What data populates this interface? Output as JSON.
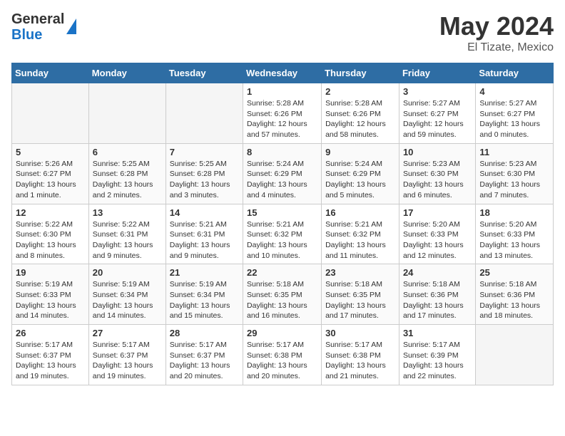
{
  "header": {
    "logo_general": "General",
    "logo_blue": "Blue",
    "title": "May 2024",
    "location": "El Tizate, Mexico"
  },
  "weekdays": [
    "Sunday",
    "Monday",
    "Tuesday",
    "Wednesday",
    "Thursday",
    "Friday",
    "Saturday"
  ],
  "weeks": [
    [
      {
        "day": "",
        "info": ""
      },
      {
        "day": "",
        "info": ""
      },
      {
        "day": "",
        "info": ""
      },
      {
        "day": "1",
        "info": "Sunrise: 5:28 AM\nSunset: 6:26 PM\nDaylight: 12 hours and 57 minutes."
      },
      {
        "day": "2",
        "info": "Sunrise: 5:28 AM\nSunset: 6:26 PM\nDaylight: 12 hours and 58 minutes."
      },
      {
        "day": "3",
        "info": "Sunrise: 5:27 AM\nSunset: 6:27 PM\nDaylight: 12 hours and 59 minutes."
      },
      {
        "day": "4",
        "info": "Sunrise: 5:27 AM\nSunset: 6:27 PM\nDaylight: 13 hours and 0 minutes."
      }
    ],
    [
      {
        "day": "5",
        "info": "Sunrise: 5:26 AM\nSunset: 6:27 PM\nDaylight: 13 hours and 1 minute."
      },
      {
        "day": "6",
        "info": "Sunrise: 5:25 AM\nSunset: 6:28 PM\nDaylight: 13 hours and 2 minutes."
      },
      {
        "day": "7",
        "info": "Sunrise: 5:25 AM\nSunset: 6:28 PM\nDaylight: 13 hours and 3 minutes."
      },
      {
        "day": "8",
        "info": "Sunrise: 5:24 AM\nSunset: 6:29 PM\nDaylight: 13 hours and 4 minutes."
      },
      {
        "day": "9",
        "info": "Sunrise: 5:24 AM\nSunset: 6:29 PM\nDaylight: 13 hours and 5 minutes."
      },
      {
        "day": "10",
        "info": "Sunrise: 5:23 AM\nSunset: 6:30 PM\nDaylight: 13 hours and 6 minutes."
      },
      {
        "day": "11",
        "info": "Sunrise: 5:23 AM\nSunset: 6:30 PM\nDaylight: 13 hours and 7 minutes."
      }
    ],
    [
      {
        "day": "12",
        "info": "Sunrise: 5:22 AM\nSunset: 6:30 PM\nDaylight: 13 hours and 8 minutes."
      },
      {
        "day": "13",
        "info": "Sunrise: 5:22 AM\nSunset: 6:31 PM\nDaylight: 13 hours and 9 minutes."
      },
      {
        "day": "14",
        "info": "Sunrise: 5:21 AM\nSunset: 6:31 PM\nDaylight: 13 hours and 9 minutes."
      },
      {
        "day": "15",
        "info": "Sunrise: 5:21 AM\nSunset: 6:32 PM\nDaylight: 13 hours and 10 minutes."
      },
      {
        "day": "16",
        "info": "Sunrise: 5:21 AM\nSunset: 6:32 PM\nDaylight: 13 hours and 11 minutes."
      },
      {
        "day": "17",
        "info": "Sunrise: 5:20 AM\nSunset: 6:33 PM\nDaylight: 13 hours and 12 minutes."
      },
      {
        "day": "18",
        "info": "Sunrise: 5:20 AM\nSunset: 6:33 PM\nDaylight: 13 hours and 13 minutes."
      }
    ],
    [
      {
        "day": "19",
        "info": "Sunrise: 5:19 AM\nSunset: 6:33 PM\nDaylight: 13 hours and 14 minutes."
      },
      {
        "day": "20",
        "info": "Sunrise: 5:19 AM\nSunset: 6:34 PM\nDaylight: 13 hours and 14 minutes."
      },
      {
        "day": "21",
        "info": "Sunrise: 5:19 AM\nSunset: 6:34 PM\nDaylight: 13 hours and 15 minutes."
      },
      {
        "day": "22",
        "info": "Sunrise: 5:18 AM\nSunset: 6:35 PM\nDaylight: 13 hours and 16 minutes."
      },
      {
        "day": "23",
        "info": "Sunrise: 5:18 AM\nSunset: 6:35 PM\nDaylight: 13 hours and 17 minutes."
      },
      {
        "day": "24",
        "info": "Sunrise: 5:18 AM\nSunset: 6:36 PM\nDaylight: 13 hours and 17 minutes."
      },
      {
        "day": "25",
        "info": "Sunrise: 5:18 AM\nSunset: 6:36 PM\nDaylight: 13 hours and 18 minutes."
      }
    ],
    [
      {
        "day": "26",
        "info": "Sunrise: 5:17 AM\nSunset: 6:37 PM\nDaylight: 13 hours and 19 minutes."
      },
      {
        "day": "27",
        "info": "Sunrise: 5:17 AM\nSunset: 6:37 PM\nDaylight: 13 hours and 19 minutes."
      },
      {
        "day": "28",
        "info": "Sunrise: 5:17 AM\nSunset: 6:37 PM\nDaylight: 13 hours and 20 minutes."
      },
      {
        "day": "29",
        "info": "Sunrise: 5:17 AM\nSunset: 6:38 PM\nDaylight: 13 hours and 20 minutes."
      },
      {
        "day": "30",
        "info": "Sunrise: 5:17 AM\nSunset: 6:38 PM\nDaylight: 13 hours and 21 minutes."
      },
      {
        "day": "31",
        "info": "Sunrise: 5:17 AM\nSunset: 6:39 PM\nDaylight: 13 hours and 22 minutes."
      },
      {
        "day": "",
        "info": ""
      }
    ]
  ]
}
